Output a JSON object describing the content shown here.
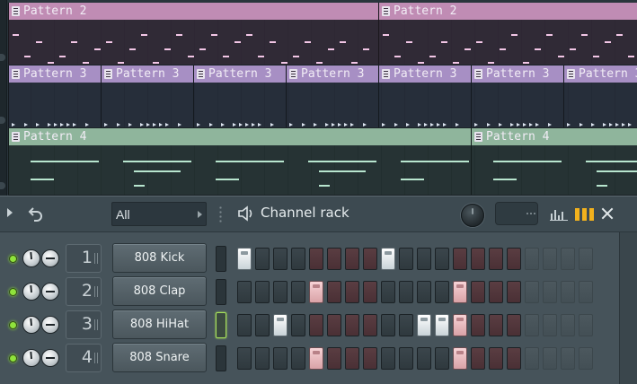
{
  "playlist": {
    "tracks": [
      {
        "clips": [
          {
            "label": "Pattern 2"
          },
          {
            "label": "Pattern 2"
          }
        ]
      },
      {
        "clips": [
          {
            "label": "Pattern 3"
          },
          {
            "label": "Pattern 3"
          },
          {
            "label": "Pattern 3"
          },
          {
            "label": "Pattern 3"
          },
          {
            "label": "Pattern 3"
          },
          {
            "label": "Pattern 3"
          },
          {
            "label": "Pattern 3"
          }
        ]
      },
      {
        "clips": [
          {
            "label": "Pattern 4"
          },
          {
            "label": "Pattern 4"
          }
        ]
      }
    ]
  },
  "channel_rack": {
    "title": "Channel rack",
    "filter": "All",
    "icons": [
      "play-arrow-icon",
      "undo-icon",
      "speaker-icon",
      "swing-knob",
      "graph-icon",
      "step-sequencer-icon",
      "close-icon"
    ],
    "channels": [
      {
        "number": "1",
        "name": "808 Kick",
        "selected": false,
        "steps": [
          1,
          0,
          0,
          0,
          0,
          0,
          0,
          0,
          1,
          0,
          0,
          0,
          0,
          0,
          0,
          0,
          0,
          0,
          0,
          0
        ]
      },
      {
        "number": "2",
        "name": "808 Clap",
        "selected": false,
        "steps": [
          0,
          0,
          0,
          0,
          1,
          0,
          0,
          0,
          0,
          0,
          0,
          0,
          1,
          0,
          0,
          0,
          0,
          0,
          0,
          0
        ]
      },
      {
        "number": "3",
        "name": "808 HiHat",
        "selected": true,
        "steps": [
          0,
          0,
          1,
          0,
          0,
          0,
          0,
          0,
          0,
          0,
          1,
          1,
          1,
          0,
          0,
          0,
          0,
          0,
          0,
          0
        ]
      },
      {
        "number": "4",
        "name": "808 Snare",
        "selected": false,
        "steps": [
          0,
          0,
          0,
          0,
          1,
          0,
          0,
          0,
          0,
          0,
          0,
          0,
          1,
          0,
          0,
          0,
          0,
          0,
          0,
          0
        ]
      }
    ],
    "colors": {
      "accent": "#f2b11d",
      "led": "#8fe23c",
      "pattern2": "#c08cb4",
      "pattern3": "#a78fc4",
      "pattern4": "#8fb59c"
    }
  }
}
